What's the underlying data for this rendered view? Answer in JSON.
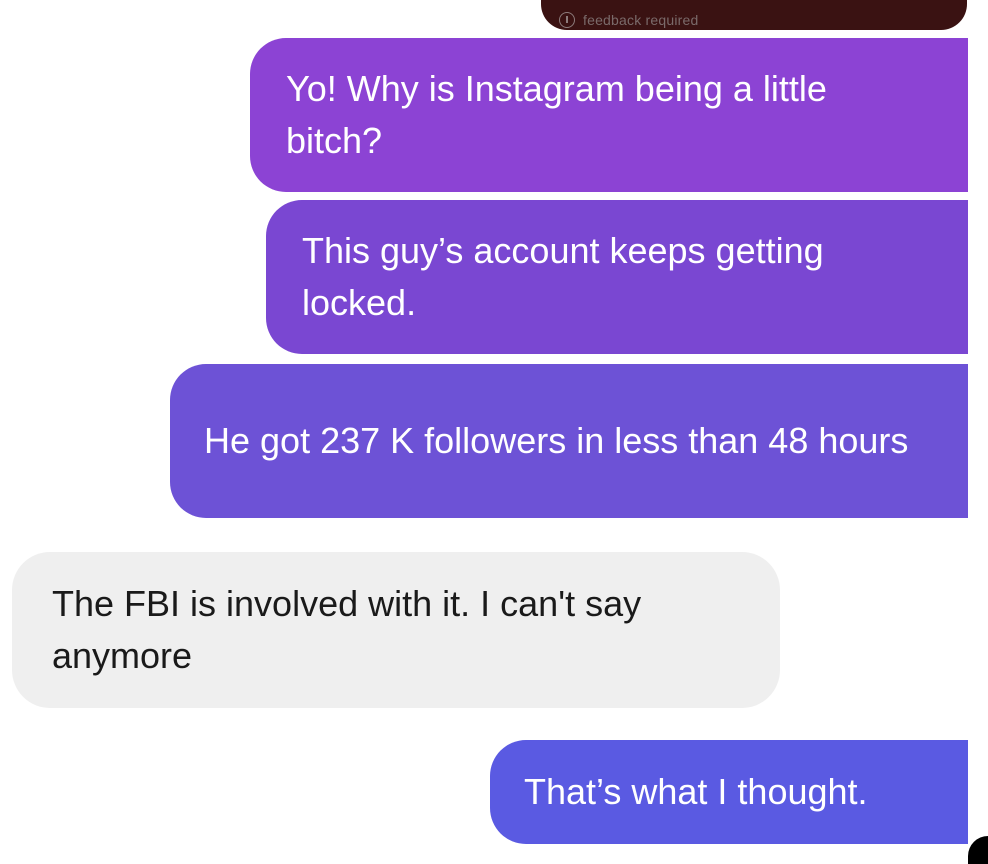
{
  "thread": {
    "top_badge": "feedback required",
    "messages": [
      {
        "sender": "me",
        "text": "Yo! Why is Instagram being a little bitch?"
      },
      {
        "sender": "me",
        "text": "This guy’s account keeps getting locked."
      },
      {
        "sender": "me",
        "text": "He got 237 K followers in less than 48 hours"
      },
      {
        "sender": "them",
        "text": "The FBI is involved with it. I can't say anymore"
      },
      {
        "sender": "me",
        "text": "That’s what I thought."
      }
    ]
  },
  "colors": {
    "top_bubble": "#3a1212",
    "sent_1": "#8c43d4",
    "sent_2": "#7a47d2",
    "sent_3": "#6d52d6",
    "received": "#efefef",
    "sent_5": "#5a5ae2"
  },
  "icons": [
    "info-icon"
  ]
}
